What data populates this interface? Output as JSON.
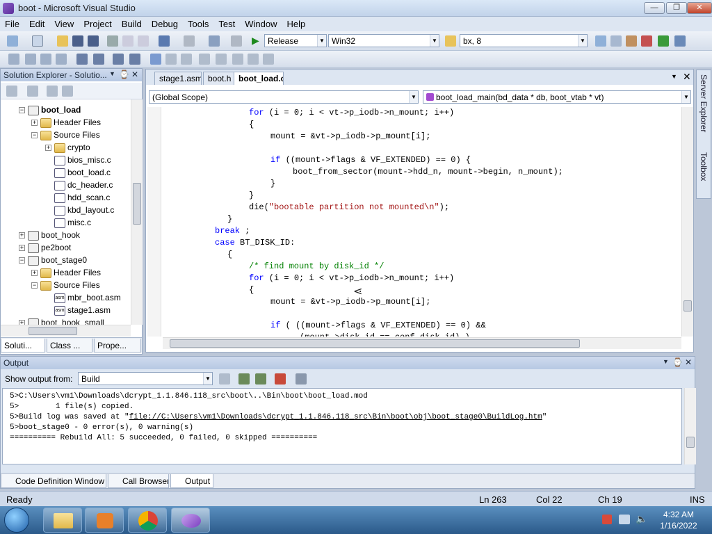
{
  "window": {
    "title": "boot - Microsoft Visual Studio"
  },
  "menu": [
    "File",
    "Edit",
    "View",
    "Project",
    "Build",
    "Debug",
    "Tools",
    "Test",
    "Window",
    "Help"
  ],
  "toolbar": {
    "config": "Release",
    "platform": "Win32",
    "find": "bx, 8"
  },
  "solution_explorer": {
    "title": "Solution Explorer - Solutio...",
    "items": [
      {
        "label": "boot_load",
        "bold": true,
        "indent": 0,
        "exp": "-",
        "icon": "proj"
      },
      {
        "label": "Header Files",
        "indent": 1,
        "exp": "+",
        "icon": "folder"
      },
      {
        "label": "Source Files",
        "indent": 1,
        "exp": "-",
        "icon": "folder"
      },
      {
        "label": "crypto",
        "indent": 2,
        "exp": "+",
        "icon": "folder"
      },
      {
        "label": "bios_misc.c",
        "indent": 2,
        "exp": "",
        "icon": "c"
      },
      {
        "label": "boot_load.c",
        "indent": 2,
        "exp": "",
        "icon": "c"
      },
      {
        "label": "dc_header.c",
        "indent": 2,
        "exp": "",
        "icon": "c"
      },
      {
        "label": "hdd_scan.c",
        "indent": 2,
        "exp": "",
        "icon": "c"
      },
      {
        "label": "kbd_layout.c",
        "indent": 2,
        "exp": "",
        "icon": "c"
      },
      {
        "label": "misc.c",
        "indent": 2,
        "exp": "",
        "icon": "c"
      },
      {
        "label": "boot_hook",
        "indent": 0,
        "exp": "+",
        "icon": "proj"
      },
      {
        "label": "pe2boot",
        "indent": 0,
        "exp": "+",
        "icon": "proj"
      },
      {
        "label": "boot_stage0",
        "indent": 0,
        "exp": "-",
        "icon": "proj"
      },
      {
        "label": "Header Files",
        "indent": 1,
        "exp": "+",
        "icon": "folder"
      },
      {
        "label": "Source Files",
        "indent": 1,
        "exp": "-",
        "icon": "folder"
      },
      {
        "label": "mbr_boot.asm",
        "indent": 2,
        "exp": "",
        "icon": "asm"
      },
      {
        "label": "stage1.asm",
        "indent": 2,
        "exp": "",
        "icon": "asm"
      },
      {
        "label": "boot_hook_small",
        "indent": 0,
        "exp": "+",
        "icon": "proj"
      }
    ],
    "tabs": [
      "Soluti...",
      "Class ...",
      "Prope..."
    ],
    "asm_badge": "asm"
  },
  "editor": {
    "tabs": [
      "stage1.asm",
      "boot.h",
      "boot_load.c"
    ],
    "scope": "(Global Scope)",
    "function": "boot_load_main(bd_data * db, boot_vtab * vt)",
    "lines": [
      [
        [
          "kw",
          "for"
        ],
        [
          "",
          "(i = 0; i < vt->p_iodb->n_mount; i++)"
        ]
      ],
      [
        [
          "",
          "{"
        ]
      ],
      [
        [
          "",
          "mount = &vt->p_iodb->p_mount[i];"
        ]
      ],
      [
        [
          "",
          ""
        ]
      ],
      [
        [
          "kw",
          "if"
        ],
        [
          "",
          "((mount->flags & VF_EXTENDED) == 0) {"
        ]
      ],
      [
        [
          "",
          "boot_from_sector(mount->hdd_n, mount->begin, n_mount);"
        ]
      ],
      [
        [
          "",
          "}"
        ]
      ],
      [
        [
          "",
          "}"
        ]
      ],
      [
        [
          "",
          "die("
        ],
        [
          "str",
          "\"bootable partition not mounted\\n\""
        ],
        [
          "",
          ");"
        ]
      ],
      [
        [
          "",
          "}"
        ]
      ],
      [
        [
          "kw",
          "break"
        ],
        [
          "",
          ";"
        ]
      ],
      [
        [
          "kw",
          "case"
        ],
        [
          "",
          "BT_DISK_ID:"
        ]
      ],
      [
        [
          "",
          "{"
        ]
      ],
      [
        [
          "cmt",
          "/* find mount by disk_id */"
        ]
      ],
      [
        [
          "kw",
          "for"
        ],
        [
          "",
          "(i = 0; i < vt->p_iodb->n_mount; i++)"
        ]
      ],
      [
        [
          "",
          "{"
        ]
      ],
      [
        [
          "",
          "mount = &vt->p_iodb->p_mount[i];"
        ]
      ],
      [
        [
          "",
          ""
        ]
      ],
      [
        [
          "kw",
          "if"
        ],
        [
          "",
          "( ((mount->flags & VF_EXTENDED) == 0) &&"
        ]
      ],
      [
        [
          "",
          "(mount->disk_id == conf.disk_id) )"
        ]
      ]
    ]
  },
  "side_strip": [
    "Server Explorer",
    "Toolbox"
  ],
  "output": {
    "title": "Output",
    "show_from_label": "Show output from:",
    "source": "Build",
    "lines": [
      "5>C:\\Users\\vm1\\Downloads\\dcrypt_1.1.846.118_src\\boot\\..\\Bin\\boot\\boot_load.mod",
      "5>        1 file(s) copied.",
      "5>Build log was saved at \"file://C:\\Users\\vm1\\Downloads\\dcrypt_1.1.846.118_src\\Bin\\boot\\obj\\boot_stage0\\BuildLog.htm\"",
      "5>boot_stage0 - 0 error(s), 0 warning(s)",
      "========== Rebuild All: 5 succeeded, 0 failed, 0 skipped =========="
    ],
    "tabs": [
      "Code Definition Window",
      "Call Browser",
      "Output"
    ]
  },
  "status": {
    "ready": "Ready",
    "ln": "Ln 263",
    "col": "Col 22",
    "ch": "Ch 19",
    "mode": "INS"
  },
  "taskbar": {
    "time": "4:32 AM",
    "date": "1/16/2022"
  }
}
